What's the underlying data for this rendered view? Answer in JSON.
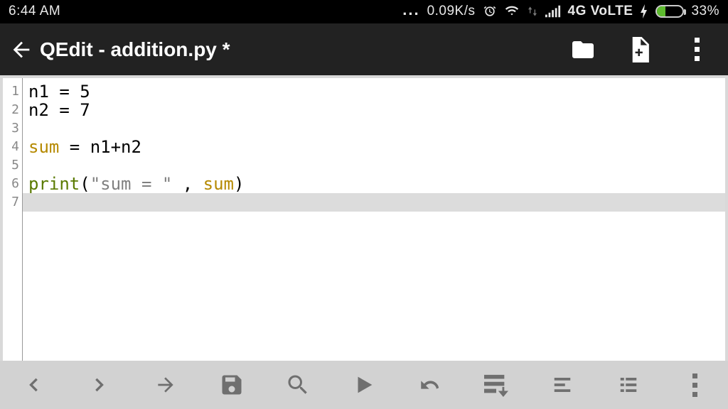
{
  "status": {
    "time": "6:44 AM",
    "net_speed": "0.09K/s",
    "net_tech": "4G VoLTE",
    "battery_pct": "33%"
  },
  "appbar": {
    "title": "QEdit - addition.py *"
  },
  "editor": {
    "current_line": 7,
    "lines": [
      {
        "n": "1",
        "tokens": [
          {
            "t": "n1 ",
            "c": ""
          },
          {
            "t": "= ",
            "c": ""
          },
          {
            "t": "5",
            "c": ""
          }
        ]
      },
      {
        "n": "2",
        "tokens": [
          {
            "t": "n2 ",
            "c": ""
          },
          {
            "t": "= ",
            "c": ""
          },
          {
            "t": "7",
            "c": ""
          }
        ]
      },
      {
        "n": "3",
        "tokens": []
      },
      {
        "n": "4",
        "tokens": [
          {
            "t": "sum",
            "c": "kw"
          },
          {
            "t": " = n1+n2",
            "c": ""
          }
        ]
      },
      {
        "n": "5",
        "tokens": []
      },
      {
        "n": "6",
        "tokens": [
          {
            "t": "print",
            "c": "fn"
          },
          {
            "t": "(",
            "c": ""
          },
          {
            "t": "\"sum = \"",
            "c": "str"
          },
          {
            "t": " , ",
            "c": ""
          },
          {
            "t": "sum",
            "c": "var"
          },
          {
            "t": ")",
            "c": ""
          }
        ]
      },
      {
        "n": "7",
        "tokens": []
      }
    ]
  }
}
